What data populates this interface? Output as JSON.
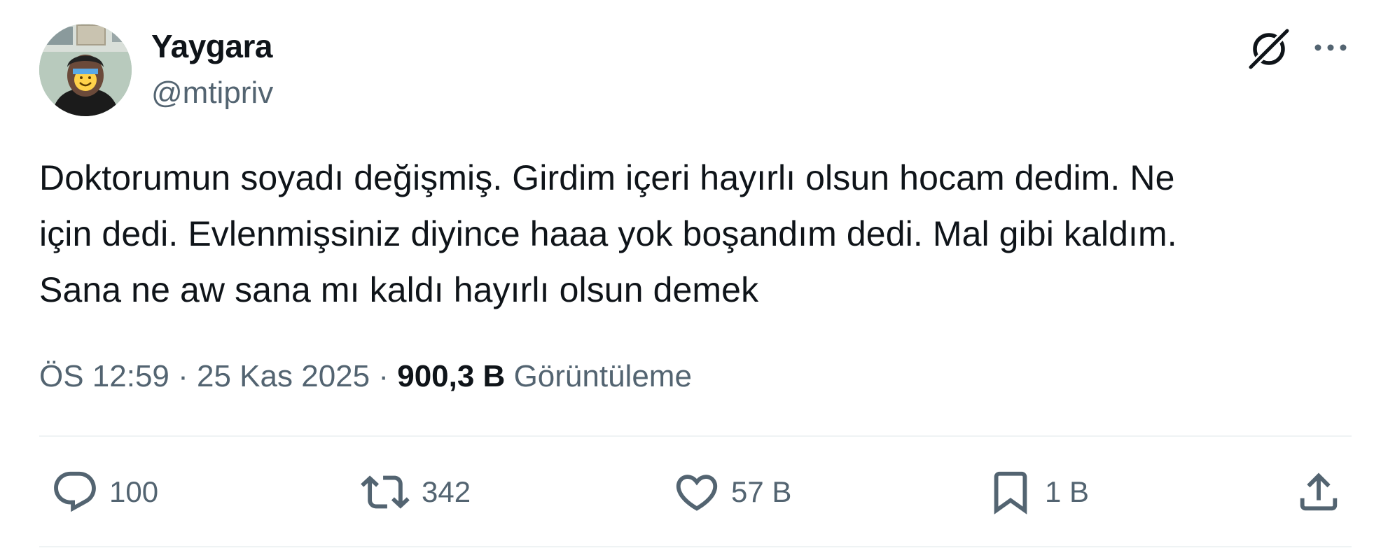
{
  "author": {
    "display_name": "Yaygara",
    "handle": "@mtipriv",
    "avatar_icon": "profile-photo"
  },
  "header_icons": {
    "grok": "grok-icon",
    "more": "more-options-icon"
  },
  "tweet": {
    "lines": [
      "Doktorumun soyadı değişmiş. Girdim içeri hayırlı olsun hocam dedim. Ne",
      "için dedi. Evlenmişsiniz diyince haaa yok boşandım dedi. Mal gibi kaldım.",
      "Sana ne aw sana mı kaldı hayırlı olsun demek"
    ]
  },
  "meta": {
    "time": "ÖS 12:59",
    "separator": " · ",
    "date": "25 Kas 2025",
    "views_count": "900,3 B",
    "views_label": "Görüntüleme"
  },
  "actions": {
    "replies": "100",
    "retweets": "342",
    "likes": "57 B",
    "bookmarks": "1 B"
  },
  "colors": {
    "text_primary": "#0f1419",
    "text_secondary": "#536471",
    "divider": "#eff3f4"
  }
}
